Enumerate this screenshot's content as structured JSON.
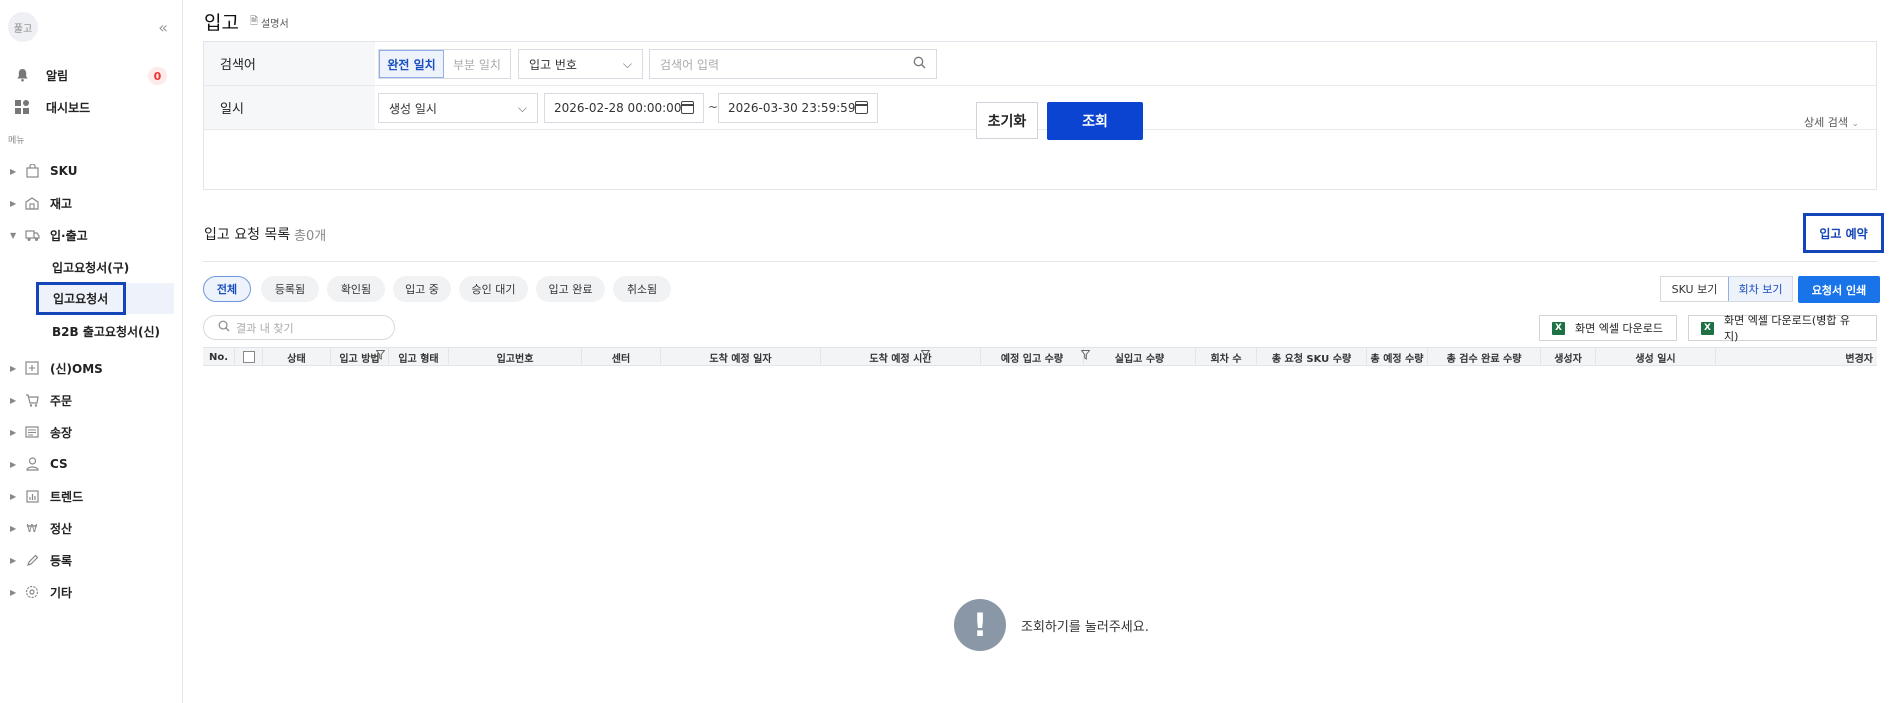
{
  "sidebar": {
    "avatar_text": "풀고",
    "collapse_icon": "«",
    "top_items": [
      {
        "label": "알림",
        "icon": "bell-icon",
        "badge": "0"
      },
      {
        "label": "대시보드",
        "icon": "dashboard-icon"
      }
    ],
    "section_label": "메뉴",
    "groups": [
      {
        "label": "SKU",
        "icon": "bag-icon"
      },
      {
        "label": "재고",
        "icon": "warehouse-icon"
      },
      {
        "label": "입·출고",
        "icon": "truck-icon",
        "expanded": true
      },
      {
        "label": "(신)OMS",
        "icon": "oms-icon"
      },
      {
        "label": "주문",
        "icon": "cart-icon"
      },
      {
        "label": "송장",
        "icon": "invoice-icon"
      },
      {
        "label": "CS",
        "icon": "person-icon"
      },
      {
        "label": "트렌드",
        "icon": "chart-icon"
      },
      {
        "label": "정산",
        "icon": "won-icon"
      },
      {
        "label": "등록",
        "icon": "pencil-icon"
      },
      {
        "label": "기타",
        "icon": "gear-icon"
      }
    ],
    "sub_items": [
      {
        "label": "입고요청서(구)"
      },
      {
        "label": "입고요청서",
        "active": true
      },
      {
        "label": "B2B 출고요청서(신)"
      }
    ]
  },
  "header": {
    "title": "입고",
    "doc_link": "설명서"
  },
  "filters": {
    "keyword_label": "검색어",
    "match_exact": "완전 일치",
    "match_partial": "부분 일치",
    "field_select": "입고 번호",
    "search_placeholder": "검색어 입력",
    "date_label": "일시",
    "date_type": "생성 일시",
    "date_from": "2026-02-28 00:00:00",
    "date_to": "2026-03-30 23:59:59",
    "tilde": "~",
    "reset_button": "초기화",
    "search_button": "조회",
    "detail_search": "상세 검색"
  },
  "list": {
    "title": "입고 요청 목록",
    "count": "총0개",
    "reserve_button": "입고 예약",
    "status_chips": [
      "전체",
      "등록됨",
      "확인됨",
      "입고 중",
      "승인 대기",
      "입고 완료",
      "취소됨"
    ],
    "view_sku": "SKU 보기",
    "view_round": "회차 보기",
    "print_button": "요청서 인쇄",
    "result_search_placeholder": "결과 내 찾기",
    "excel_download": "화면 엑셀 다운로드",
    "excel_download_merged": "화면 엑셀 다운로드(병합 유지)",
    "excel_icon": "X",
    "columns": [
      "No.",
      "",
      "상태",
      "입고 방법",
      "입고 형태",
      "입고번호",
      "센터",
      "도착 예정 일자",
      "도착 예정 시간",
      "예정 입고 수량",
      "실입고 수량",
      "회차 수",
      "총 요청 SKU 수량",
      "총 예정 수량",
      "총 검수 완료 수량",
      "생성자",
      "생성 일시",
      "변경자"
    ],
    "empty_message": "조회하기를 눌러주세요."
  }
}
